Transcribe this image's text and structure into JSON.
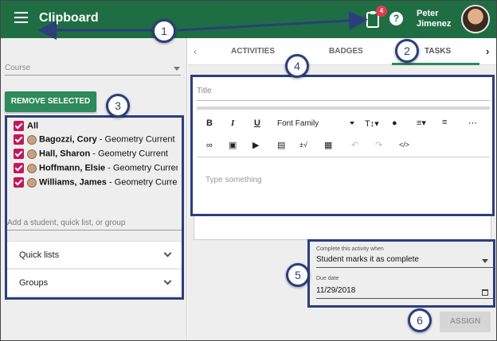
{
  "header": {
    "app_title": "Clipboard",
    "notification_count": "4",
    "help_glyph": "?",
    "user_first": "Peter",
    "user_last": "Jimenez",
    "brand_color": "#1f6e43",
    "icons": [
      "hamburger-menu-icon",
      "clipboard-icon",
      "help-icon"
    ]
  },
  "left_panel": {
    "course_placeholder": "Course",
    "remove_button": "REMOVE SELECTED",
    "select_all_label": "All",
    "students": [
      {
        "name": "Bagozzi, Cory",
        "group": " - Geometry Current"
      },
      {
        "name": "Hall, Sharon",
        "group": " - Geometry Current"
      },
      {
        "name": "Hoffmann, Elsie",
        "group": " - Geometry Current"
      },
      {
        "name": "Williams, James",
        "group": " - Geometry Current"
      }
    ],
    "add_placeholder": "Add a student, quick list, or group",
    "accordions": [
      {
        "label": "Quick lists"
      },
      {
        "label": "Groups"
      }
    ],
    "checkbox_color": "#c2185b"
  },
  "tabs": {
    "items": [
      {
        "label": "ACTIVITIES"
      },
      {
        "label": "BADGES"
      },
      {
        "label": "TASKS",
        "active": true
      }
    ]
  },
  "editor": {
    "title_placeholder": "Title",
    "font_family": "Font Family",
    "body_placeholder": "Type something",
    "toolbar_row1": [
      "bold-icon",
      "italic-icon",
      "underline-icon",
      "font-size-icon",
      "color-drop-icon",
      "align-icon",
      "ordered-list-icon",
      "bullet-list-icon"
    ],
    "toolbar_row2": [
      "link-icon",
      "image-icon",
      "video-icon",
      "file-icon",
      "math-icon",
      "table-icon",
      "undo-icon",
      "redo-icon",
      "code-icon"
    ]
  },
  "completion": {
    "label": "Complete this activity when",
    "value": "Student marks it as complete",
    "due_label": "Due date",
    "due_value": "11/29/2018"
  },
  "assign_button": "ASSIGN",
  "callouts": [
    "1",
    "2",
    "3",
    "4",
    "5",
    "6"
  ],
  "callout_color": "#2c3e7c"
}
